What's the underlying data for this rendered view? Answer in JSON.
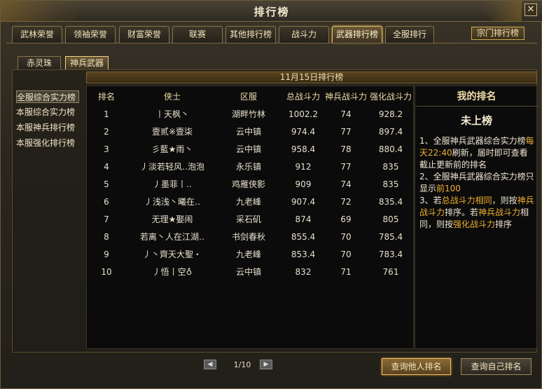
{
  "window": {
    "title": "排行榜",
    "close_label": "✕"
  },
  "top_tabs": [
    {
      "label": "武林荣誉"
    },
    {
      "label": "领袖荣誉"
    },
    {
      "label": "财富荣誉"
    },
    {
      "label": "联赛"
    },
    {
      "label": "其他排行榜"
    },
    {
      "label": "战斗力"
    },
    {
      "label": "武器排行榜",
      "active": true
    },
    {
      "label": "全服排行"
    }
  ],
  "top_right_button": "宗门排行榜",
  "sub_tabs": [
    {
      "label": "赤灵珠"
    },
    {
      "label": "神兵武器",
      "active": true
    }
  ],
  "side_nav": [
    {
      "label": "全服综合实力榜",
      "active": true
    },
    {
      "label": "本服综合实力榜"
    },
    {
      "label": "本服神兵排行榜"
    },
    {
      "label": "本服强化排行榜"
    }
  ],
  "date_banner": "11月15日排行榜",
  "table": {
    "headers": [
      "排名",
      "侠士",
      "区服",
      "总战斗力",
      "神兵战斗力",
      "强化战斗力"
    ],
    "rows": [
      [
        "1",
        "丨天枫丶",
        "湖畔竹林",
        "1002.2",
        "74",
        "928.2"
      ],
      [
        "2",
        "壹贰※壹柒",
        "云中镇",
        "974.4",
        "77",
        "897.4"
      ],
      [
        "3",
        "彡藍★雨丶",
        "云中镇",
        "958.4",
        "78",
        "880.4"
      ],
      [
        "4",
        "丿淡若轻风‥泡泡",
        "永乐镇",
        "912",
        "77",
        "835"
      ],
      [
        "5",
        "丿墨菲丨‥",
        "鸡雁侠影",
        "909",
        "74",
        "835"
      ],
      [
        "6",
        "丿浅浅丶曦在‥",
        "九老峰",
        "907.4",
        "72",
        "835.4"
      ],
      [
        "7",
        "无理★娶闹",
        "采石矶",
        "874",
        "69",
        "805"
      ],
      [
        "8",
        "若离丶人在江湖‥",
        "书剑春秋",
        "855.4",
        "70",
        "785.4"
      ],
      [
        "9",
        "丿丶齊天大聖・",
        "九老峰",
        "853.4",
        "70",
        "783.4"
      ],
      [
        "10",
        "丿悟丨空♁",
        "云中镇",
        "832",
        "71",
        "761"
      ]
    ]
  },
  "my_rank": {
    "title": "我的排名",
    "status": "未上榜",
    "note1_a": "1、全服神兵武器综合实力榜",
    "note1_hl": "每天22:40",
    "note1_b": "刷新，届时即可查看截止更新前的排名",
    "note2_a": "2、全服神兵武器综合实力榜只显示",
    "note2_hl": "前100",
    "note3_a": "3、若",
    "note3_hl1": "总战斗力相同",
    "note3_b": "，则按",
    "note3_hl2": "神兵战斗力",
    "note3_c": "排序。若",
    "note3_hl3": "神兵战斗力",
    "note3_d": "相同，则按",
    "note3_hl4": "强化战斗力",
    "note3_e": "排序"
  },
  "pager": {
    "prev": "◀",
    "next": "▶",
    "text": "1/10"
  },
  "buttons": {
    "query_others": "查询他人排名",
    "query_self": "查询自己排名"
  }
}
